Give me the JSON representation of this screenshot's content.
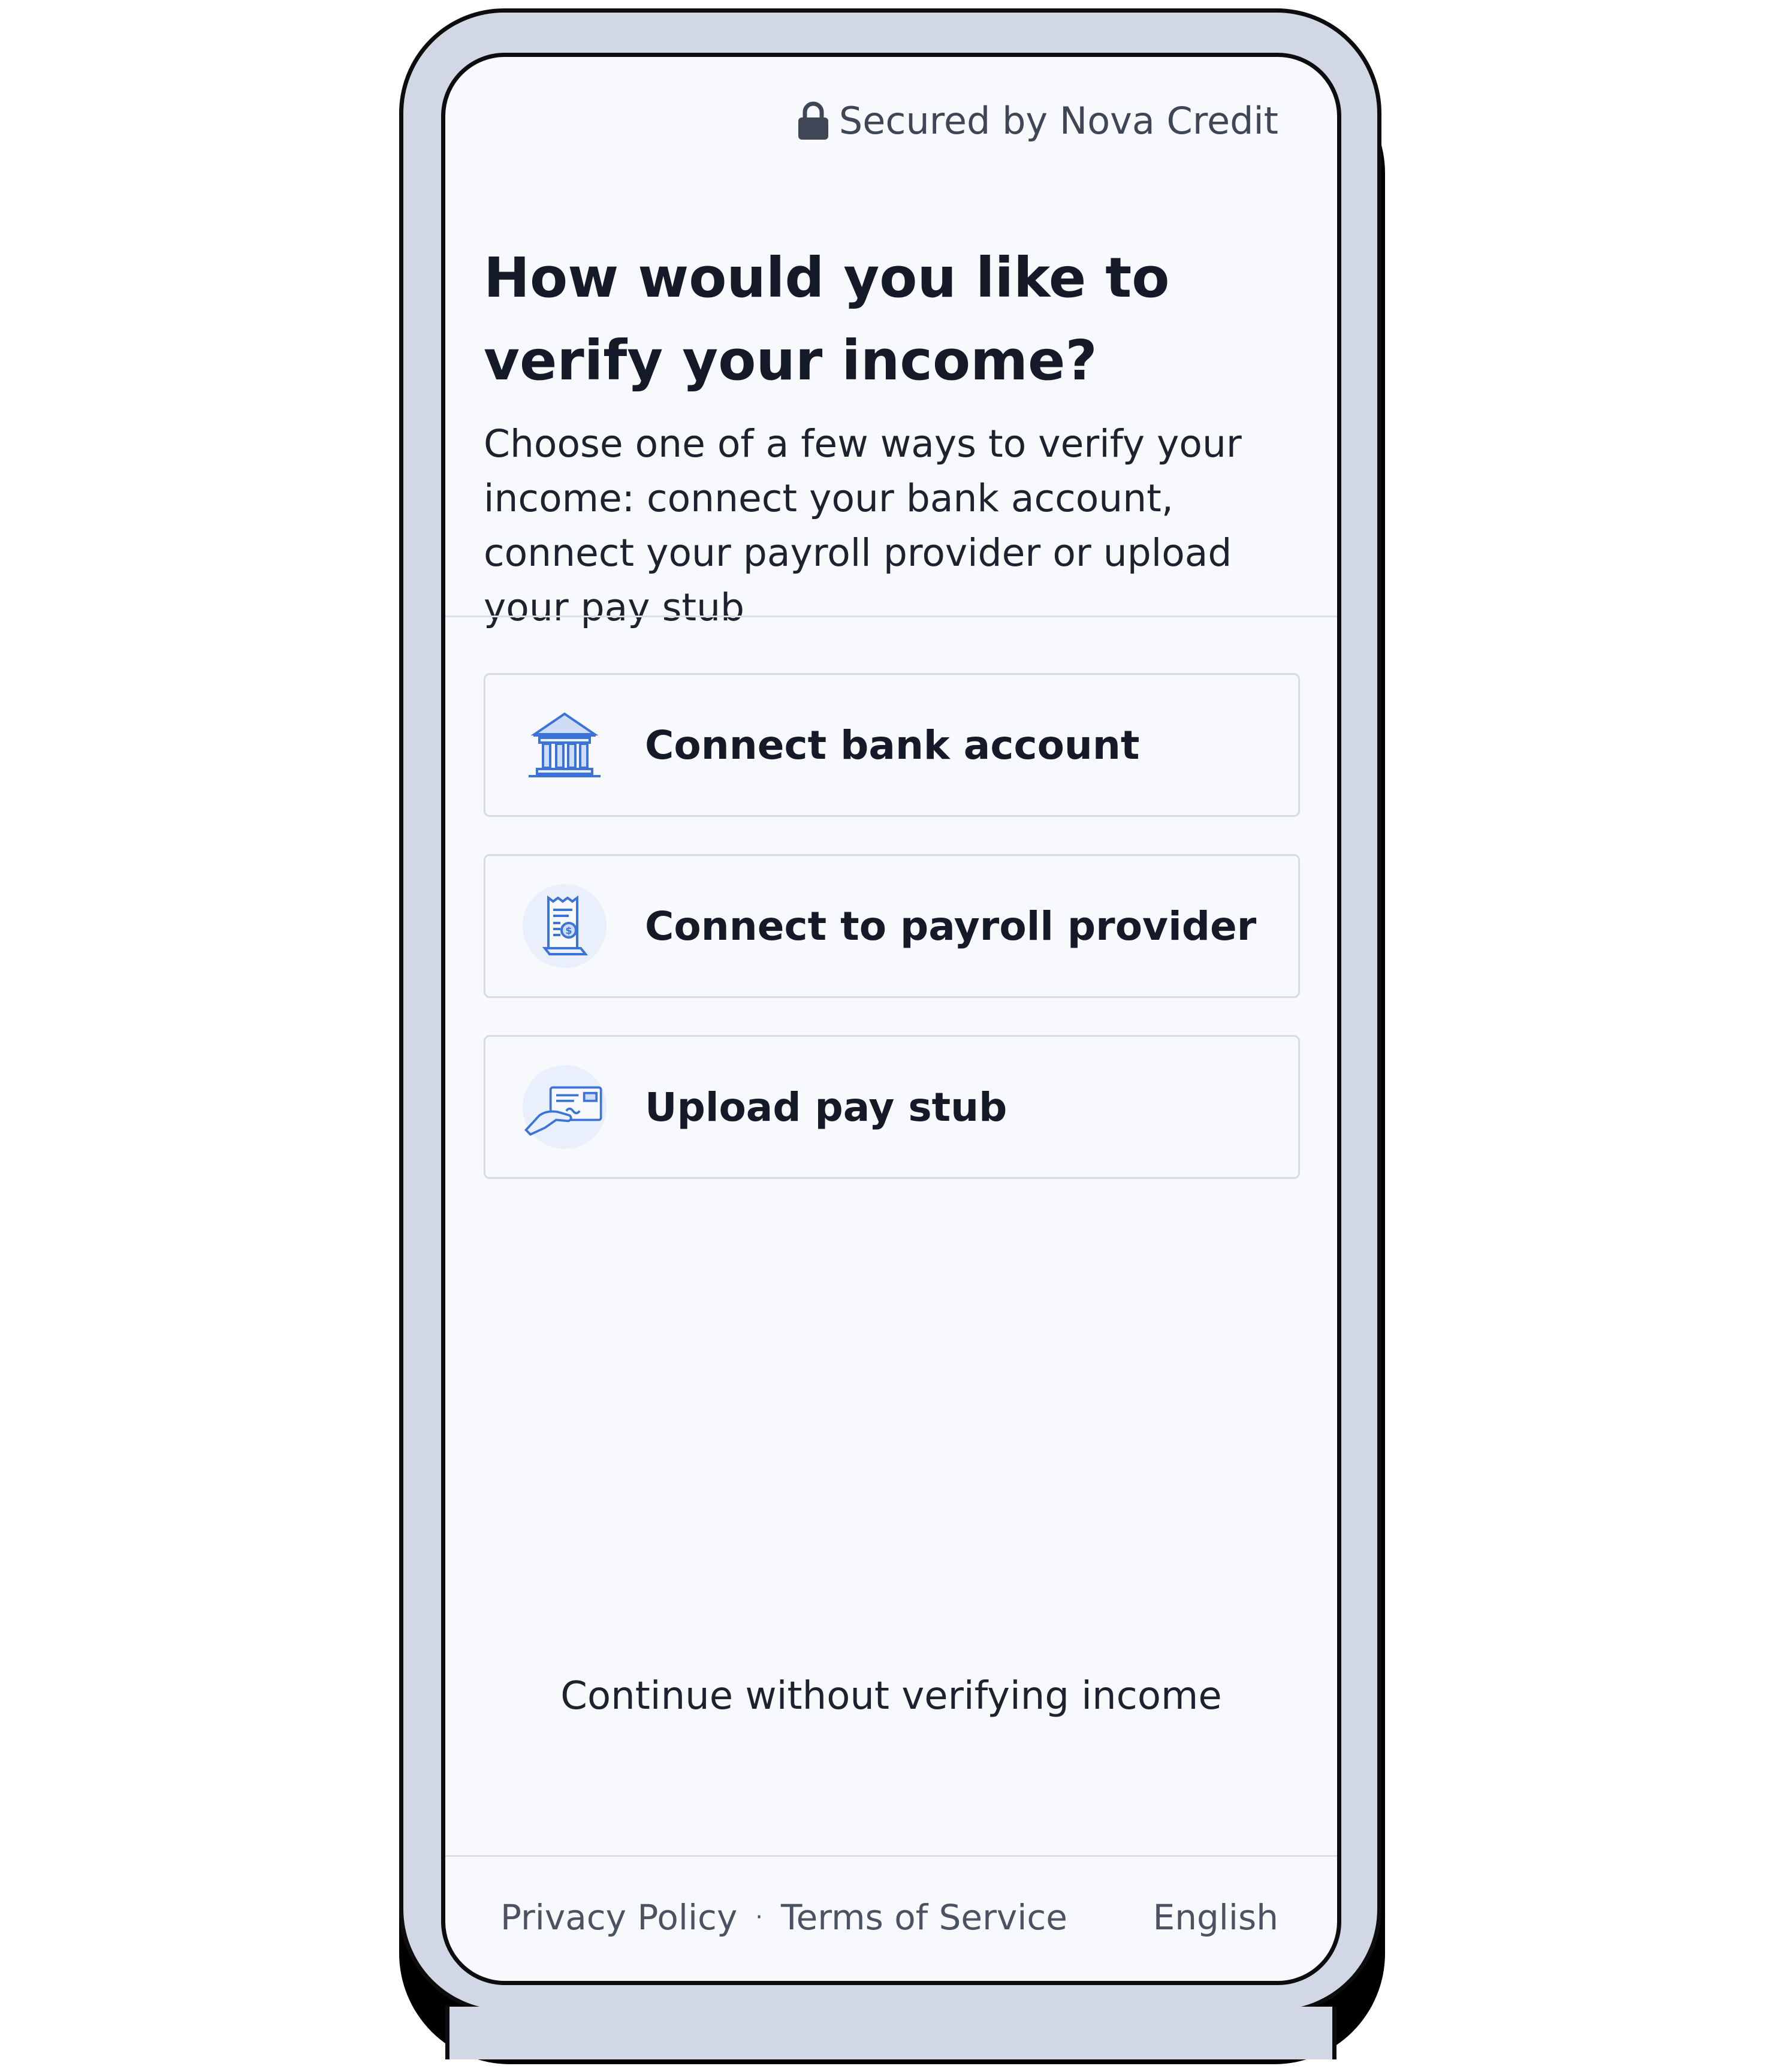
{
  "header": {
    "secured_label": "Secured by Nova Credit"
  },
  "main": {
    "title": "How would you like to verify your income?",
    "subtitle": "Choose one of a few ways to verify your income: connect your bank account, connect your payroll provider or upload your pay stub",
    "options": [
      {
        "label": "Connect bank account",
        "icon": "bank-icon"
      },
      {
        "label": "Connect to payroll provider",
        "icon": "payroll-receipt-icon"
      },
      {
        "label": "Upload pay stub",
        "icon": "pay-stub-icon"
      }
    ],
    "continue_label": "Continue without verifying income"
  },
  "footer": {
    "privacy": "Privacy Policy",
    "separator": "·",
    "terms": "Terms of Service",
    "language": "English"
  },
  "colors": {
    "icon_blue": "#3b73d9",
    "icon_bg": "#e9f0fc",
    "text_dark": "#141a27",
    "frame": "#d1d7e5"
  }
}
